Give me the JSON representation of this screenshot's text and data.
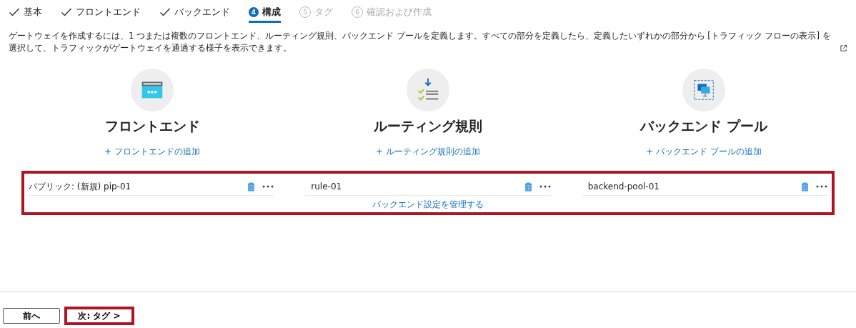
{
  "steps": [
    {
      "label": "基本",
      "completed": true,
      "selected": false,
      "disabled": false
    },
    {
      "label": "フロントエンド",
      "completed": true,
      "selected": false,
      "disabled": false
    },
    {
      "label": "バックエンド",
      "completed": true,
      "selected": false,
      "disabled": false
    },
    {
      "number": "4",
      "label": "構成",
      "completed": false,
      "selected": true,
      "disabled": false
    },
    {
      "number": "5",
      "label": "タグ",
      "completed": false,
      "selected": false,
      "disabled": true
    },
    {
      "number": "6",
      "label": "確認および作成",
      "completed": false,
      "selected": false,
      "disabled": true
    }
  ],
  "description": "ゲートウェイを作成するには、1 つまたは複数のフロントエンド、ルーティング規則、バックエンド プールを定義します。すべての部分を定義したら、定義したいずれかの部分から [トラフィック フローの表示] を選択して、トラフィックがゲートウェイを通過する様子を表示できます。",
  "sections": [
    {
      "kind": "frontend",
      "title": "フロントエンド",
      "add_link": "+ フロントエンドの追加"
    },
    {
      "kind": "rules",
      "title": "ルーティング規則",
      "add_link": "+ ルーティング規則の追加"
    },
    {
      "kind": "backend",
      "title": "バックエンド プール",
      "add_link": "+ バックエンド プールの追加"
    }
  ],
  "entries": {
    "highlighted": true,
    "columns": [
      {
        "name": "パブリック: (新規) pip-01"
      },
      {
        "name": "rule-01",
        "link": "バックエンド設定を管理する"
      },
      {
        "name": "backend-pool-01"
      }
    ]
  },
  "footer": {
    "previous": "前へ",
    "next": "次: タグ >",
    "next_highlighted": true
  }
}
